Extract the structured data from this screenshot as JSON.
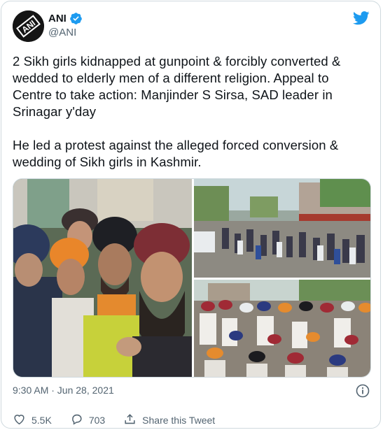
{
  "tweet": {
    "display_name": "ANI",
    "handle": "@ANI",
    "avatar_text": "ANI",
    "paragraphs": [
      "2 Sikh girls kidnapped at gunpoint & forcibly converted & wedded to elderly men of a different religion. Appeal to Centre to take action: Manjinder S Sirsa, SAD leader in Srinagar y'day",
      "He led a protest against the alleged forced conversion & wedding of Sikh girls in Kashmir."
    ],
    "timestamp": "9:30 AM · Jun 28, 2021",
    "likes": "5.5K",
    "replies": "703",
    "share_label": "Share this Tweet"
  },
  "colors": {
    "twitter_blue": "#1d9bf0",
    "secondary_text": "#536471",
    "border": "#cfd9de"
  },
  "icons": [
    "verified-badge-icon",
    "twitter-bird-icon",
    "info-icon",
    "heart-icon",
    "reply-icon",
    "share-icon"
  ]
}
